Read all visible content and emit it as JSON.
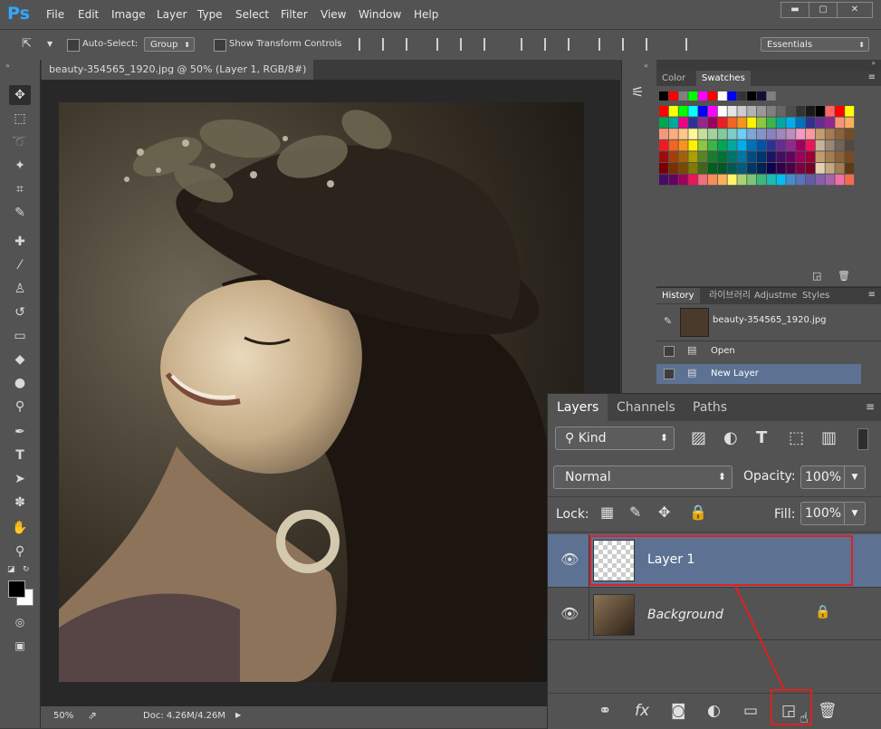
{
  "app": {
    "logo": "Ps"
  },
  "menu": [
    "File",
    "Edit",
    "Image",
    "Layer",
    "Type",
    "Select",
    "Filter",
    "View",
    "Window",
    "Help"
  ],
  "window_controls": {
    "minimize": "▬",
    "maximize": "▢",
    "close": "✕"
  },
  "options": {
    "auto_select_label": "Auto-Select:",
    "auto_select_value": "Group",
    "show_transform_label": "Show Transform Controls",
    "workspace": "Essentials"
  },
  "document": {
    "tab_title": "beauty-354565_1920.jpg @ 50% (Layer 1, RGB/8#) *",
    "zoom": "50%",
    "doc_size": "Doc: 4.26M/4.26M"
  },
  "color_panel": {
    "tabs": [
      "Color",
      "Swatches"
    ],
    "active_tab": "Swatches"
  },
  "history_panel": {
    "tabs": [
      "History",
      "라이브러리",
      "Adjustme",
      "Styles"
    ],
    "snapshot_name": "beauty-354565_1920.jpg",
    "steps": [
      "Open",
      "New Layer"
    ],
    "active_step": "New Layer"
  },
  "layers_panel": {
    "tabs": [
      "Layers",
      "Channels",
      "Paths"
    ],
    "kind_label": "Kind",
    "blend_mode": "Normal",
    "opacity_label": "Opacity:",
    "opacity_value": "100%",
    "lock_label": "Lock:",
    "fill_label": "Fill:",
    "fill_value": "100%",
    "layers": [
      {
        "name": "Layer 1",
        "selected": true
      },
      {
        "name": "Background",
        "selected": false,
        "locked": true
      }
    ]
  },
  "colors": {
    "ui_bg": "#535353",
    "selected_row": "#5d7293",
    "highlight_red": "#e02020"
  }
}
